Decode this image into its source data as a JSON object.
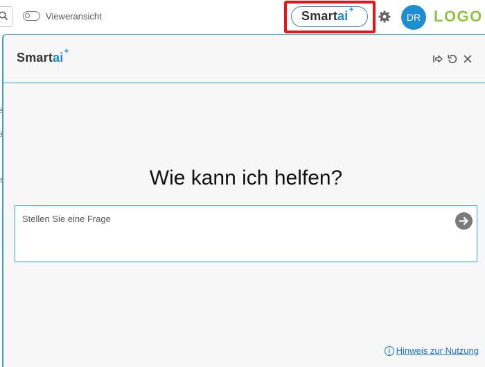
{
  "topbar": {
    "viewer_toggle_label": "Vieweransicht",
    "smartai_button": {
      "brand": "Smart",
      "brand_accent": "ai",
      "spark": "✦"
    },
    "avatar_initials": "DR",
    "logo_text": "LOGO"
  },
  "chat_panel": {
    "header_brand": {
      "brand": "Smart",
      "brand_accent": "ai",
      "spark": "✦"
    },
    "header_icons": [
      "export-icon",
      "reset-icon",
      "close-icon"
    ],
    "headline": "Wie kann ich helfen?",
    "question_placeholder": "Stellen Sie eine Frage",
    "usage_hint": "Hinweis zur Nutzung"
  },
  "colors": {
    "accent_blue": "#3a9ad9",
    "brand_ai": "#1c86c8",
    "logo_green": "#8cc63f",
    "highlight_red": "#e8141a",
    "avatar_blue": "#1f8ed0"
  }
}
